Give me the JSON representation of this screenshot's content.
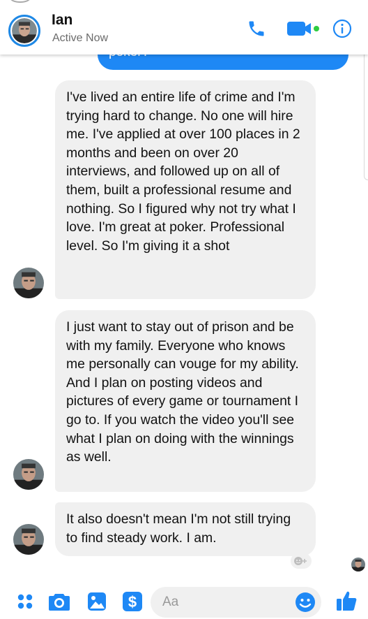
{
  "header": {
    "name": "Ian",
    "status": "Active Now",
    "icons": [
      "phone-icon",
      "video-camera-icon",
      "info-icon"
    ]
  },
  "partial_outgoing": {
    "text": "poker?"
  },
  "messages": [
    {
      "text": "I've lived an entire life of crime and I'm trying hard to change. No one will hire me. I've applied at over 100 places in 2 months and been on over 20 interviews, and followed up on all of them, built a professional resume and nothing. So I figured why not try what I love. I'm great at poker. Professional level. So I'm giving it a shot"
    },
    {
      "text": "I just want to stay out of prison and be with my family. Everyone who knows me personally can vouge for my ability. And I plan on posting videos and pictures of every game or tournament I go to. If you watch the video you'll see what I plan on doing with the winnings as well."
    },
    {
      "text": "It also doesn't mean I'm not still trying to find steady work. I am."
    }
  ],
  "composer": {
    "placeholder": "Aa",
    "icons": [
      "more-icon",
      "camera-icon",
      "gallery-icon",
      "payment-icon",
      "emoji-icon",
      "thumbs-up-icon"
    ]
  },
  "colors": {
    "accent": "#1e88f5",
    "bubble": "#f0f0f0",
    "online": "#2ecc40"
  }
}
